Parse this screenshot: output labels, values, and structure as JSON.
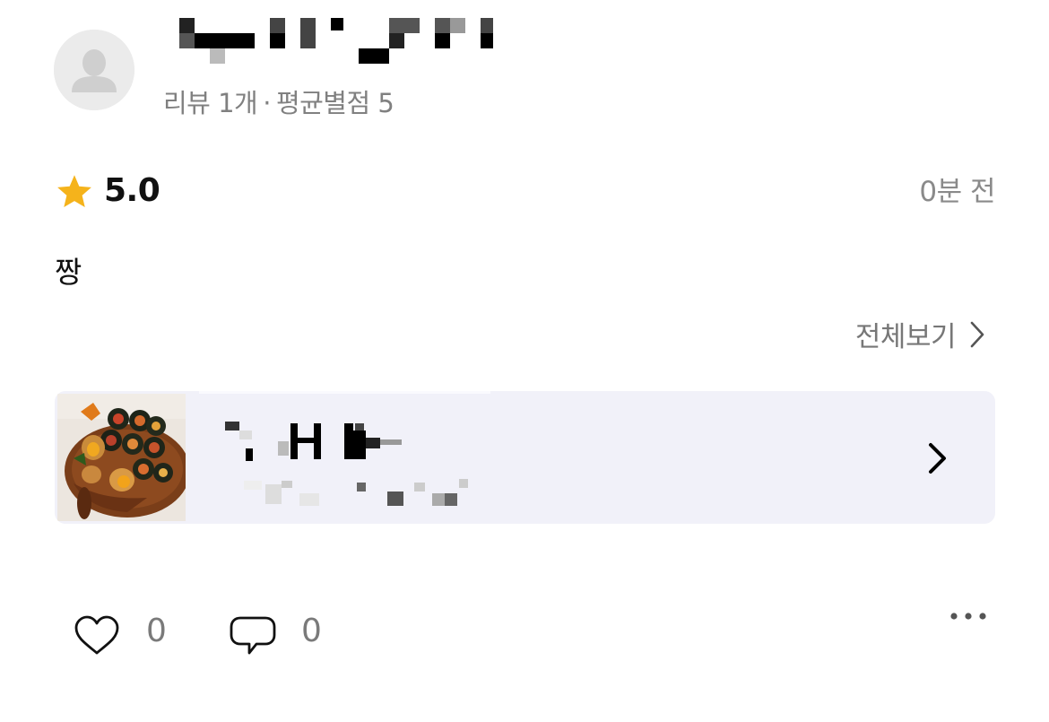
{
  "user": {
    "avatar_icon": "default-avatar-icon",
    "meta_review_count": "리뷰 1개",
    "meta_separator": "·",
    "meta_average": "평균별점 5"
  },
  "review": {
    "star_icon": "star-icon",
    "star_color": "#F5B31B",
    "rating": "5.0",
    "time_ago": "0분 전",
    "text": "짱",
    "see_all_label": "전체보기"
  },
  "product_card": {
    "background": "#F1F1F9",
    "arrow_icon": "chevron-right-icon"
  },
  "footer": {
    "like_icon": "heart-outline-icon",
    "like_count": "0",
    "comment_icon": "speech-bubble-icon",
    "comment_count": "0",
    "more_icon": "more-dots-icon"
  }
}
